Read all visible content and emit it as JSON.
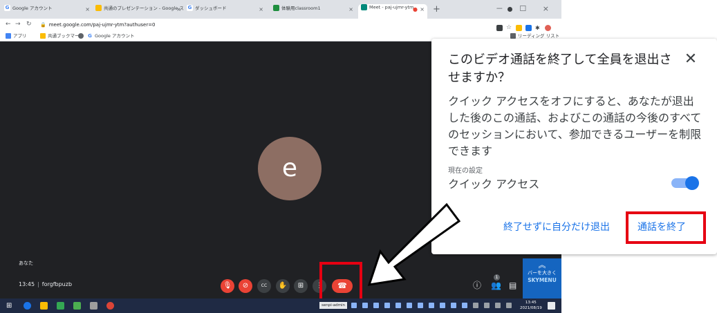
{
  "browser": {
    "tabs": [
      {
        "label": "Google アカウント",
        "favicon": "google-icon",
        "color": "#4285f4"
      },
      {
        "label": "共通のプレゼンテーション - Google スライド",
        "favicon": "slides-icon",
        "color": "#fbbc04"
      },
      {
        "label": "ダッシュボード",
        "favicon": "google-icon",
        "color": "#4285f4"
      },
      {
        "label": "体験用classroom1",
        "favicon": "classroom-icon",
        "color": "#1e8e3e"
      },
      {
        "label": "Meet - paj-ujmr-ytm",
        "favicon": "meet-icon",
        "color": "#00897b"
      }
    ],
    "window_controls": "－ ☐ ×",
    "url": "meet.google.com/paj-ujmr-ytm?authuser=0",
    "bookmarks": [
      {
        "label": "アプリ",
        "icon": "apps-icon"
      },
      {
        "label": "共通ブックマーク",
        "icon": "folder-icon"
      },
      {
        "label": "",
        "icon": "globe-icon"
      },
      {
        "label": "Google アカウント",
        "icon": "google-icon"
      }
    ],
    "reading_list": "リーディング リスト"
  },
  "meet": {
    "avatar_letter": "e",
    "you_label": "あなた",
    "time": "13:45",
    "meeting_code": "forgfbpuzb",
    "people_count": "1"
  },
  "skymenu": {
    "label": "バーを大きく",
    "brand": "SKYMENU"
  },
  "taskbar": {
    "user": "senpi-admin",
    "clock_time": "13:45",
    "clock_date": "2021/08/19"
  },
  "dialog": {
    "title": "このビデオ通話を終了して全員を退出させますか？",
    "body": "クイック アクセスをオフにすると、あなたが退出した後のこの通話、およびこの通話の今後のすべてのセッションにおいて、参加できるユーザーを制限できます",
    "setting_label": "現在の設定",
    "setting_name": "クイック アクセス",
    "toggle_on": true,
    "leave_button": "終了せずに自分だけ退出",
    "end_button": "通話を終了"
  },
  "colors": {
    "accent": "#1a73e8",
    "danger": "#ea4335",
    "highlight": "#e60012",
    "stage_bg": "#202124"
  }
}
